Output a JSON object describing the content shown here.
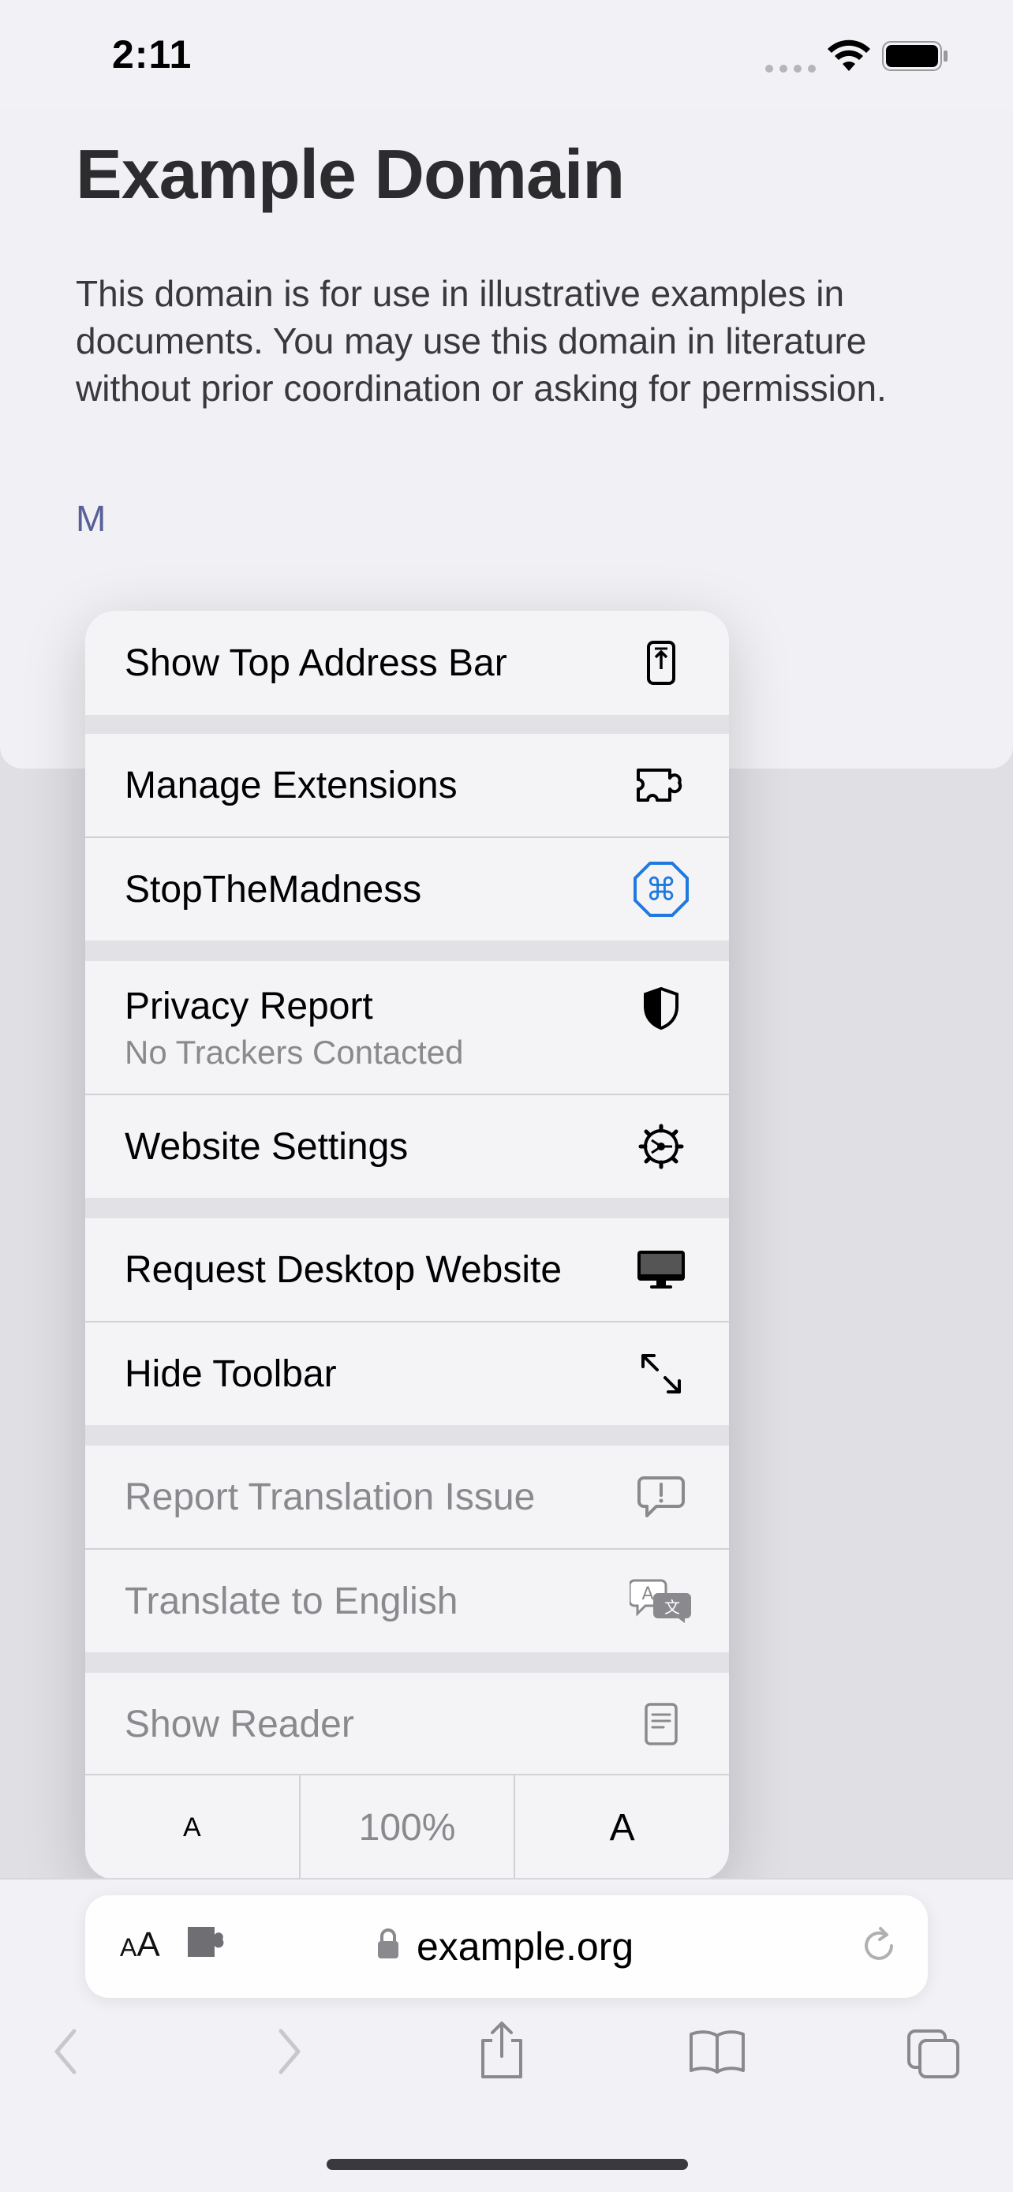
{
  "status_bar": {
    "time": "2:11"
  },
  "page": {
    "title": "Example Domain",
    "body": "This domain is for use in illustrative examples in documents. You may use this domain in literature without prior coordination or asking for permission.",
    "link_fragment": "M"
  },
  "menu": {
    "show_top_address_bar": "Show Top Address Bar",
    "manage_extensions": "Manage Extensions",
    "stop_the_madness": "StopTheMadness",
    "privacy_report": "Privacy Report",
    "privacy_report_sub": "No Trackers Contacted",
    "website_settings": "Website Settings",
    "request_desktop": "Request Desktop Website",
    "hide_toolbar": "Hide Toolbar",
    "report_translation": "Report Translation Issue",
    "translate": "Translate to English",
    "show_reader": "Show Reader",
    "zoom_smaller": "A",
    "zoom_level": "100%",
    "zoom_larger": "A"
  },
  "address_bar": {
    "aa_small": "A",
    "aa_large": "A",
    "url": "example.org"
  },
  "colors": {
    "accent": "#1f7ae0",
    "disabled": "#8a8a8e"
  }
}
